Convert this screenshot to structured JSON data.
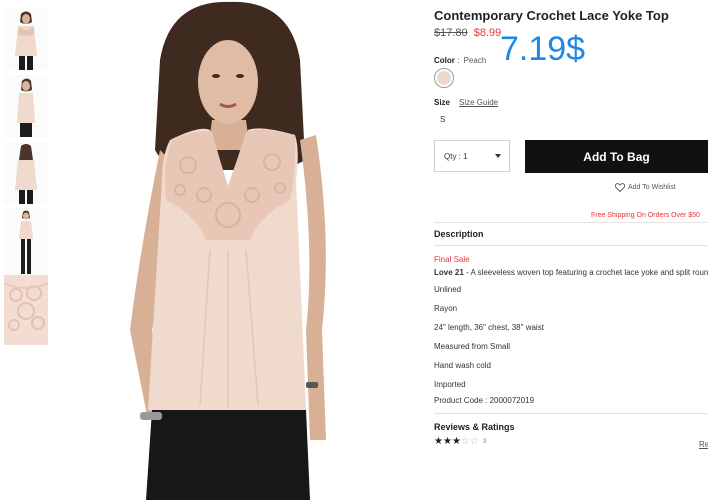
{
  "product": {
    "title": "Contemporary Crochet Lace Yoke Top",
    "old_price": "$17.80",
    "sale_price": "$8.99",
    "big_price": "7.19$"
  },
  "color": {
    "label": "Color",
    "separator": ":",
    "value": "Peach",
    "swatch_hex": "#ecd8cf"
  },
  "size": {
    "label": "Size",
    "guide_label": "Size Guide",
    "options": [
      "S"
    ]
  },
  "qty": {
    "label": "Qty : 1"
  },
  "actions": {
    "add_to_bag": "Add To Bag",
    "wishlist": "Add To Wishlist",
    "free_shipping": "Free Shipping On Orders Over $50"
  },
  "description": {
    "heading": "Description",
    "final_sale": "Final Sale",
    "brand": "Love 21",
    "summary": " - A sleeveless woven top featuring a crochet lace yoke and split round ne",
    "lines": [
      "Unlined",
      "Rayon",
      "24\" length, 36\" chest, 38\" waist",
      "Measured from Small",
      "Hand wash cold",
      "Imported"
    ],
    "product_code": "Product Code : 2000072019"
  },
  "reviews": {
    "heading": "Reviews & Ratings",
    "rating": 3,
    "max": 5,
    "count": "3",
    "link": "Re"
  },
  "colors": {
    "accent_blue": "#1e88e5",
    "sale_red": "#e8363a",
    "button_black": "#111111",
    "garment_peach": "#f0d9cd"
  },
  "images": {
    "thumbnails": [
      "front-view",
      "side-view",
      "back-view",
      "full-length-view",
      "lace-detail"
    ],
    "main": "model-front-view"
  }
}
